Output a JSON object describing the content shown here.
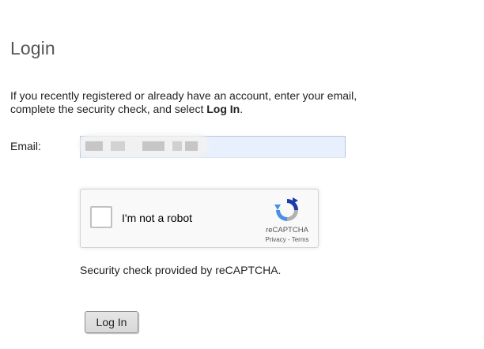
{
  "page": {
    "title": "Login",
    "intro_text": "If you recently registered or already have an account, enter your email, complete the security check, and select ",
    "intro_bold": "Log In",
    "intro_end": "."
  },
  "form": {
    "email_label": "Email:",
    "email_value": "",
    "email_redacted": true
  },
  "recaptcha": {
    "checkbox_label": "I'm not a robot",
    "checked": false,
    "brand": "reCAPTCHA",
    "privacy_label": "Privacy",
    "separator": " - ",
    "terms_label": "Terms",
    "logo_icon": "recaptcha-logo-icon",
    "colors": {
      "logo_blue": "#4a90e2",
      "logo_dark_blue": "#1c3aa9",
      "logo_gray": "#b1b1b1"
    }
  },
  "security_note": "Security check provided by reCAPTCHA.",
  "buttons": {
    "login_label": "Log In"
  }
}
